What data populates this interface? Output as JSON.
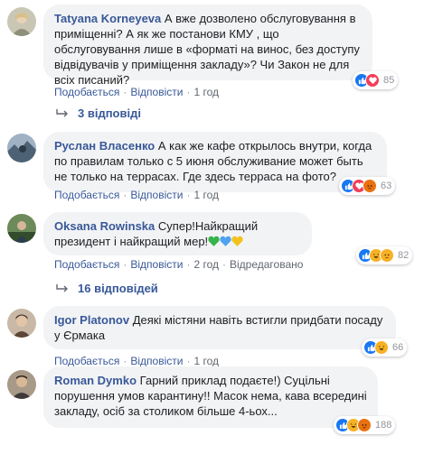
{
  "comments": [
    {
      "author": "Tatyana Korneyeva",
      "text": "А вже дозволено обслуговування в приміщенні? А як же постанови КМУ , що обслуговування лише в «форматі на винос, без доступу відвідувачів у приміщення закладу»? Чи Закон не для всіх писаний?",
      "like": "Подобається",
      "reply": "Відповісти",
      "time": "1 год",
      "reaction_count": "85",
      "reactions": [
        "like",
        "love"
      ],
      "avatar_color": "#b7b9a4"
    },
    {
      "author": "Руслан Власенко",
      "text": "А как же кафе открылось внутри, когда по правилам только с 5 июня обслуживание может быть не только на террасах. Где здесь терраса на фото?",
      "like": "Подобається",
      "reply": "Відповісти",
      "time": "1 год",
      "reaction_count": "63",
      "reactions": [
        "like",
        "love",
        "angry"
      ],
      "avatar_color": "#5f7488"
    },
    {
      "author": "Oksana Rowinska",
      "text": "Супер!Найкращий президент і найкращий мер!",
      "hearts": [
        "#36b34a",
        "#4da3f0",
        "#f3c21b"
      ],
      "like": "Подобається",
      "reply": "Відповісти",
      "time": "2 год",
      "edited": "Відредаговано",
      "reaction_count": "82",
      "reactions": [
        "like",
        "haha",
        "sad"
      ],
      "avatar_color": "#3f5a3a"
    },
    {
      "author": "Igor Platonov",
      "text": "Деякі містяни навіть встигли придбати посаду у Єрмака",
      "like": "Подобається",
      "reply": "Відповісти",
      "time": "1 год",
      "reaction_count": "66",
      "reactions": [
        "like",
        "haha"
      ],
      "avatar_color": "#8a6a55"
    },
    {
      "author": "Roman Dymko",
      "text": "Гарний приклад подаєте!) Суцільні порушення умов карантину!! Масок нема, кава всередині закладу, осіб за столиком більше 4-ьох...",
      "like": "Подобається",
      "reply": "Відповісти",
      "time": "1 год",
      "reaction_count": "188",
      "reactions": [
        "like",
        "haha",
        "angry"
      ],
      "avatar_color": "#6b5a48"
    }
  ],
  "replies_1": "3 відповіді",
  "replies_3": "16 відповідей",
  "colors": {
    "link": "#385898",
    "bubble": "#f2f3f5",
    "like": "#1877f2",
    "love": "#f33e58",
    "haha": "#f7b125",
    "angry": "#e9710f"
  }
}
